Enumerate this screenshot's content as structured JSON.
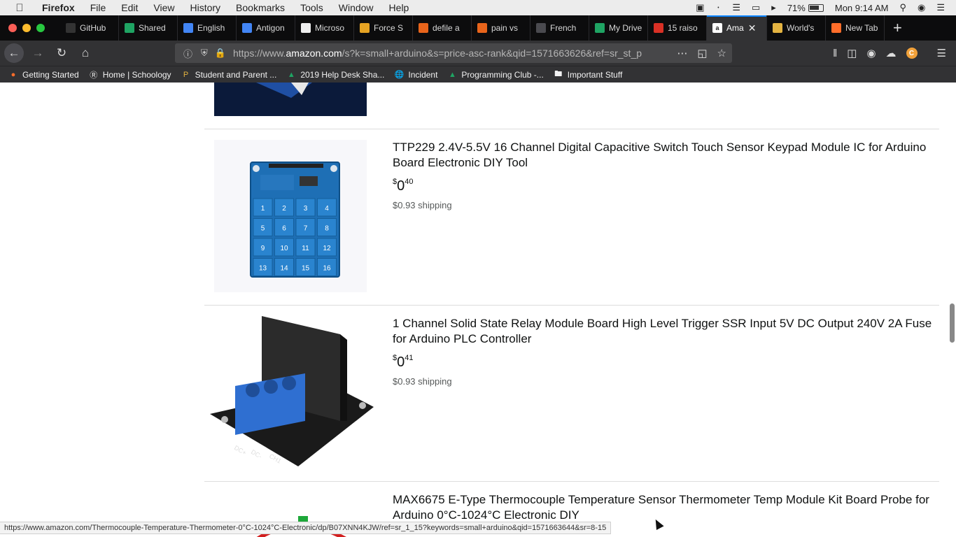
{
  "menubar": {
    "app": "Firefox",
    "items": [
      "File",
      "Edit",
      "View",
      "History",
      "Bookmarks",
      "Tools",
      "Window",
      "Help"
    ],
    "battery": "71%",
    "clock": "Mon 9:14 AM"
  },
  "tabs": [
    {
      "label": "GitHub",
      "icon_color": "#333"
    },
    {
      "label": "Shared",
      "icon_color": "#1fa463"
    },
    {
      "label": "English",
      "icon_color": "#4285f4"
    },
    {
      "label": "Antigon",
      "icon_color": "#4285f4"
    },
    {
      "label": "Microso",
      "icon_color": "#eeeeee"
    },
    {
      "label": "Force S",
      "icon_color": "#e6a323"
    },
    {
      "label": "defile a",
      "icon_color": "#e8641b"
    },
    {
      "label": "pain vs",
      "icon_color": "#e8641b"
    },
    {
      "label": "French",
      "icon_color": "#4a4a4f"
    },
    {
      "label": "My Drive",
      "icon_color": "#1fa463"
    },
    {
      "label": "15 raiso",
      "icon_color": "#d93025"
    },
    {
      "label": "Ama",
      "icon_color": "#ffffff",
      "active": true
    },
    {
      "label": "World's",
      "icon_color": "#e3b341"
    },
    {
      "label": "New Tab",
      "icon_color": "#ff6d2a"
    }
  ],
  "toolbar": {
    "url_prefix": "https://www.",
    "url_domain": "amazon.com",
    "url_rest": "/s?k=small+arduino&s=price-asc-rank&qid=1571663626&ref=sr_st_p"
  },
  "bookmarks": [
    {
      "label": "Getting Started",
      "icon": "firefox-icon"
    },
    {
      "label": "Home | Schoology",
      "icon": "schoology-icon"
    },
    {
      "label": "Student and Parent ...",
      "icon": "parent-icon"
    },
    {
      "label": "2019 Help Desk Sha...",
      "icon": "drive-icon"
    },
    {
      "label": "Incident",
      "icon": "globe-icon"
    },
    {
      "label": "Programming Club -...",
      "icon": "drive-icon"
    },
    {
      "label": "Important Stuff",
      "icon": "folder-icon"
    }
  ],
  "products": [
    {
      "title": "TTP229 2.4V-5.5V 16 Channel Digital Capacitive Switch Touch Sensor Keypad Module IC for Arduino Board Electronic DIY Tool",
      "price_symbol": "$",
      "price_whole": "0",
      "price_fraction": "40",
      "shipping": "$0.93 shipping",
      "keypad_keys": [
        "1",
        "2",
        "3",
        "4",
        "5",
        "6",
        "7",
        "8",
        "9",
        "10",
        "11",
        "12",
        "13",
        "14",
        "15",
        "16"
      ]
    },
    {
      "title": "1 Channel Solid State Relay Module Board High Level Trigger SSR Input 5V DC Output 240V 2A Fuse for Arduino PLC Controller",
      "price_symbol": "$",
      "price_whole": "0",
      "price_fraction": "41",
      "shipping": "$0.93 shipping",
      "terminal_labels": [
        "DC+",
        "DC-",
        "CH1"
      ]
    },
    {
      "title": "MAX6675 E-Type Thermocouple Temperature Sensor Thermometer Temp Module Kit Board Probe for Arduino 0°C-1024°C Electronic DIY"
    }
  ],
  "status_url": "https://www.amazon.com/Thermocouple-Temperature-Thermometer-0°C-1024°C-Electronic/dp/B07XNN4KJW/ref=sr_1_15?keywords=small+arduino&qid=1571663644&sr=8-15"
}
